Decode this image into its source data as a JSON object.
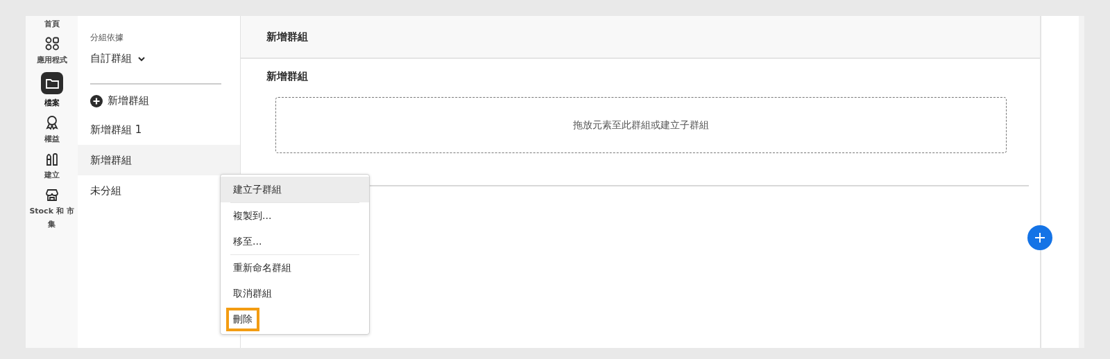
{
  "rail": {
    "items": [
      {
        "label": "首頁",
        "selected": false
      },
      {
        "label": "應用程式",
        "selected": false
      },
      {
        "label": "檔案",
        "selected": true
      },
      {
        "label": "權益",
        "selected": false
      },
      {
        "label": "建立",
        "selected": false
      },
      {
        "label": "Stock 和 市集",
        "selected": false
      }
    ]
  },
  "groups_panel": {
    "group_by_label": "分組依據",
    "group_by_value": "自訂群組",
    "add_group": "新增群組",
    "groups": [
      {
        "label": "新增群組 1",
        "selected": false
      },
      {
        "label": "新增群組",
        "selected": true
      },
      {
        "label": "未分組",
        "selected": false
      }
    ]
  },
  "main": {
    "header_title": "新增群組",
    "section_title": "新增群組",
    "dropzone_text": "拖放元素至此群組或建立子群組"
  },
  "context_menu": {
    "sections": [
      [
        {
          "label": "建立子群組",
          "hovered": true,
          "highlighted": false
        }
      ],
      [
        {
          "label": "複製到...",
          "hovered": false,
          "highlighted": false
        },
        {
          "label": "移至...",
          "hovered": false,
          "highlighted": false
        }
      ],
      [
        {
          "label": "重新命名群組",
          "hovered": false,
          "highlighted": false
        },
        {
          "label": "取消群組",
          "hovered": false,
          "highlighted": false
        },
        {
          "label": "刪除",
          "hovered": false,
          "highlighted": true
        }
      ]
    ]
  }
}
